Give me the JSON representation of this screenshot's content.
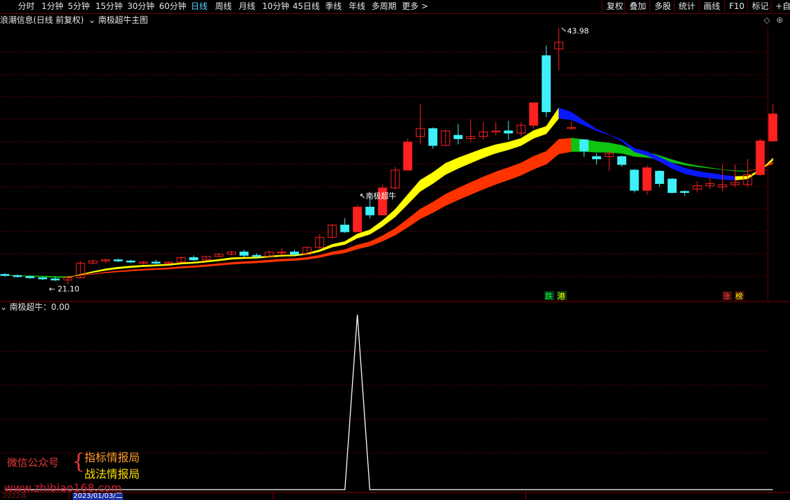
{
  "toolbar": {
    "periods": [
      {
        "label": "分时"
      },
      {
        "label": "1分钟"
      },
      {
        "label": "5分钟"
      },
      {
        "label": "15分钟"
      },
      {
        "label": "30分钟"
      },
      {
        "label": "60分钟"
      },
      {
        "label": "日线"
      },
      {
        "label": "周线"
      },
      {
        "label": "月线"
      },
      {
        "label": "10分钟"
      },
      {
        "label": "45日线"
      },
      {
        "label": "季线"
      },
      {
        "label": "年线"
      },
      {
        "label": "多周期"
      },
      {
        "label": "更多 >"
      }
    ],
    "active": "日线",
    "actions": [
      {
        "label": "复权"
      },
      {
        "label": "叠加"
      },
      {
        "label": "多股"
      },
      {
        "label": "统计"
      },
      {
        "label": "画线"
      },
      {
        "label": "F10"
      },
      {
        "label": "标记"
      },
      {
        "label": "+自选"
      }
    ]
  },
  "main_chart": {
    "title": "浪潮信息(日线 前复权)",
    "indicator": "南极超牛主图",
    "high_label": "43.98",
    "low_label": "21.10",
    "signal_label": "南极超牛",
    "tags": [
      "跌",
      "港",
      "涨",
      "榜"
    ],
    "colors": {
      "up": "#ff2020",
      "down": "#3ff0f8",
      "yellow": "#ffff00",
      "red_band": "#ff3300",
      "blue": "#0a18ff",
      "green": "#0fc40f",
      "grid": "#6b0000"
    }
  },
  "sub_chart": {
    "title": "南极超牛：0.00"
  },
  "watermark": {
    "account_label": "微信公众号",
    "brace": "{",
    "line1": "指标情报局",
    "line2": "战法情报局",
    "url": "www.zhibiao168.com"
  },
  "axis": {
    "date_label": "2023/01/03/二",
    "year_label": "2022年"
  },
  "chart_data": {
    "type": "candlestick",
    "price_range": [
      21.1,
      43.98
    ],
    "signal_values_note": "single spike to 1 at the signal bar, otherwise 0",
    "candles": [
      [
        22.0,
        22.1,
        21.8,
        21.9
      ],
      [
        21.9,
        22.0,
        21.7,
        21.8
      ],
      [
        21.8,
        21.9,
        21.6,
        21.7
      ],
      [
        21.7,
        21.8,
        21.5,
        21.6
      ],
      [
        21.6,
        21.8,
        21.4,
        21.5
      ],
      [
        21.5,
        21.9,
        21.1,
        21.7
      ],
      [
        21.7,
        23.2,
        21.7,
        23.0
      ],
      [
        23.0,
        23.3,
        22.9,
        23.2
      ],
      [
        23.2,
        23.4,
        23.0,
        23.3
      ],
      [
        23.3,
        23.4,
        23.1,
        23.2
      ],
      [
        23.2,
        23.3,
        23.0,
        23.1
      ],
      [
        23.1,
        23.2,
        22.9,
        23.1
      ],
      [
        23.1,
        23.3,
        22.9,
        23.0
      ],
      [
        23.0,
        23.1,
        22.9,
        23.1
      ],
      [
        23.1,
        23.6,
        23.0,
        23.5
      ],
      [
        23.5,
        23.7,
        23.2,
        23.3
      ],
      [
        23.3,
        23.6,
        23.2,
        23.6
      ],
      [
        23.6,
        23.9,
        23.5,
        23.8
      ],
      [
        23.8,
        24.1,
        23.7,
        24.0
      ],
      [
        24.0,
        24.2,
        23.5,
        23.7
      ],
      [
        23.7,
        23.9,
        23.5,
        23.6
      ],
      [
        23.6,
        24.1,
        23.6,
        24.0
      ],
      [
        24.0,
        24.3,
        23.7,
        24.0
      ],
      [
        24.0,
        24.2,
        23.6,
        23.8
      ],
      [
        23.8,
        24.5,
        23.8,
        24.4
      ],
      [
        24.4,
        25.6,
        24.3,
        25.3
      ],
      [
        25.3,
        26.5,
        25.2,
        26.4
      ],
      [
        26.4,
        27.0,
        25.7,
        25.8
      ],
      [
        25.8,
        28.2,
        25.8,
        28.0
      ],
      [
        28.0,
        28.8,
        27.0,
        27.3
      ],
      [
        27.3,
        30.0,
        27.3,
        29.7
      ],
      [
        29.7,
        31.6,
        29.6,
        31.3
      ],
      [
        31.3,
        34.1,
        31.3,
        33.8
      ],
      [
        34.3,
        37.2,
        33.6,
        35.0
      ],
      [
        35.0,
        35.1,
        33.2,
        33.5
      ],
      [
        33.5,
        34.9,
        33.5,
        34.8
      ],
      [
        34.4,
        35.4,
        33.6,
        34.1
      ],
      [
        34.1,
        35.8,
        33.8,
        34.3
      ],
      [
        34.3,
        35.6,
        34.0,
        34.7
      ],
      [
        34.7,
        35.6,
        34.4,
        34.8
      ],
      [
        34.8,
        35.7,
        34.0,
        34.6
      ],
      [
        34.6,
        35.6,
        34.3,
        35.3
      ],
      [
        35.3,
        37.1,
        35.0,
        37.3
      ],
      [
        41.5,
        42.4,
        36.0,
        36.5
      ],
      [
        42.1,
        43.98,
        40.2,
        42.7
      ],
      [
        35.0,
        35.6,
        34.9,
        35.1
      ],
      [
        34.0,
        34.0,
        32.5,
        33.0
      ],
      [
        32.5,
        32.8,
        31.8,
        32.3
      ],
      [
        32.5,
        33.0,
        31.2,
        32.8
      ],
      [
        32.5,
        32.6,
        31.6,
        31.8
      ],
      [
        31.3,
        31.4,
        29.3,
        29.5
      ],
      [
        29.5,
        31.7,
        29.1,
        31.5
      ],
      [
        31.2,
        31.3,
        29.8,
        30.1
      ],
      [
        30.5,
        30.6,
        29.2,
        29.3
      ],
      [
        29.4,
        29.5,
        29.0,
        29.3
      ],
      [
        29.6,
        30.3,
        29.3,
        29.9
      ],
      [
        29.9,
        30.6,
        29.6,
        30.1
      ],
      [
        29.8,
        31.8,
        29.4,
        30.0
      ],
      [
        30.0,
        31.8,
        29.8,
        30.2
      ],
      [
        30.0,
        32.3,
        29.8,
        30.9
      ],
      [
        30.9,
        34.1,
        30.8,
        33.9
      ],
      [
        33.9,
        37.2,
        33.8,
        36.3
      ]
    ]
  }
}
